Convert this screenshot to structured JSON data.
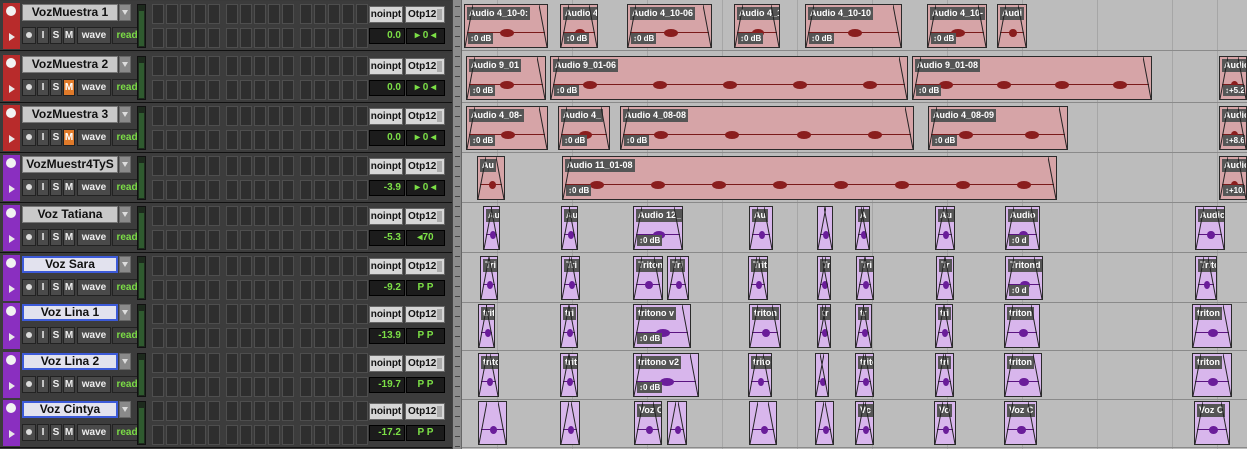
{
  "colors": {
    "audio_track_strip": "#b82b2b",
    "instrument_track_strip": "#8a2fc0",
    "audio_clip": "#d6a4a7",
    "instrument_clip": "#d8b6ec",
    "read_text": "#7bdc46",
    "mute_active": "#e07a2a"
  },
  "tracks": [
    {
      "name": "VozMuestra 1",
      "selected": false,
      "type": "audio",
      "input": "noinpt",
      "output": "Otp12",
      "volume": "0.0",
      "pan": "▸ 0 ◂",
      "mute_on": false,
      "rec": "●",
      "i": "I",
      "s": "S",
      "m": "M",
      "view": "wave",
      "automation": "read"
    },
    {
      "name": "VozMuestra 2",
      "selected": false,
      "type": "audio",
      "input": "noinpt",
      "output": "Otp12",
      "volume": "0.0",
      "pan": "▸ 0 ◂",
      "mute_on": true,
      "rec": "●",
      "i": "I",
      "s": "S",
      "m": "M",
      "view": "wave",
      "automation": "read"
    },
    {
      "name": "VozMuestra 3",
      "selected": false,
      "type": "audio",
      "input": "noinpt",
      "output": "Otp12",
      "volume": "0.0",
      "pan": "▸ 0 ◂",
      "mute_on": true,
      "rec": "●",
      "i": "I",
      "s": "S",
      "m": "M",
      "view": "wave",
      "automation": "read"
    },
    {
      "name": "VozMuestr4TyS",
      "selected": false,
      "type": "instrument",
      "input": "noinpt",
      "output": "Otp12",
      "volume": "-3.9",
      "pan": "▸ 0 ◂",
      "mute_on": false,
      "rec": "●",
      "i": "I",
      "s": "S",
      "m": "M",
      "view": "wave",
      "automation": "read"
    },
    {
      "name": "Voz Tatiana",
      "selected": false,
      "type": "instrument",
      "input": "noinpt",
      "output": "Otp12",
      "volume": "-5.3",
      "pan": "◂70",
      "mute_on": false,
      "rec": "●",
      "i": "I",
      "s": "S",
      "m": "M",
      "view": "wave",
      "automation": "read"
    },
    {
      "name": "Voz Sara",
      "selected": true,
      "type": "instrument",
      "input": "noinpt",
      "output": "Otp12",
      "volume": "-9.2",
      "pan": "P  P",
      "mute_on": false,
      "rec": "●",
      "i": "I",
      "s": "S",
      "m": "M",
      "view": "wave",
      "automation": "read"
    },
    {
      "name": "Voz Lina 1",
      "selected": true,
      "type": "instrument",
      "input": "noinpt",
      "output": "Otp12",
      "volume": "-13.9",
      "pan": "P  P",
      "mute_on": false,
      "rec": "●",
      "i": "I",
      "s": "S",
      "m": "M",
      "view": "wave",
      "automation": "read"
    },
    {
      "name": "Voz Lina 2",
      "selected": true,
      "type": "instrument",
      "input": "noinpt",
      "output": "Otp12",
      "volume": "-19.7",
      "pan": "P  P",
      "mute_on": false,
      "rec": "●",
      "i": "I",
      "s": "S",
      "m": "M",
      "view": "wave",
      "automation": "read"
    },
    {
      "name": "Voz Cintya",
      "selected": true,
      "type": "instrument",
      "input": "noinpt",
      "output": "Otp12",
      "volume": "-17.2",
      "pan": "P  P",
      "mute_on": false,
      "rec": "●",
      "i": "I",
      "s": "S",
      "m": "M",
      "view": "wave",
      "automation": "read"
    }
  ],
  "lanes": [
    {
      "color": "red",
      "clips": [
        {
          "label": "Audio 4_10-0:",
          "gain": "0 dB"
        },
        {
          "label": "Audio 4",
          "gain": "0 dB"
        },
        {
          "label": "Audio 4_10-06",
          "gain": "0 dB"
        },
        {
          "label": "Audio 4_1(",
          "gain": "0 dB"
        },
        {
          "label": "Audio 4_10-10",
          "gain": "0 dB"
        },
        {
          "label": "Audio 4_10-",
          "gain": "0 dB"
        },
        {
          "label": "Audi",
          "gain": ""
        }
      ]
    },
    {
      "color": "red",
      "clips": [
        {
          "label": "Audio 9_01",
          "gain": "0 dB"
        },
        {
          "label": "Audio 9_01-06",
          "gain": "0 dB"
        },
        {
          "label": "Audio 9_01-08",
          "gain": "0 dB"
        },
        {
          "label": "Audio !",
          "gain": "+5.2"
        }
      ]
    },
    {
      "color": "red",
      "clips": [
        {
          "label": "Audio 4_08-",
          "gain": "0 dB"
        },
        {
          "label": "Audio 4_",
          "gain": "0 dB"
        },
        {
          "label": "Audio 4_08-08",
          "gain": "0 dB"
        },
        {
          "label": "Audio 4_08-09",
          "gain": "0 dB"
        },
        {
          "label": "Audio ",
          "gain": "+8.6"
        }
      ]
    },
    {
      "color": "red",
      "clips": [
        {
          "label": "Au",
          "gain": ""
        },
        {
          "label": "Audio 11_01-08",
          "gain": "0 dB"
        },
        {
          "label": "Audio 1",
          "gain": "+10."
        }
      ]
    },
    {
      "color": "purple",
      "clips": [
        {
          "label": "Au",
          "gain": ""
        },
        {
          "label": "Au",
          "gain": ""
        },
        {
          "label": "Audio 12_",
          "gain": "0 dB"
        },
        {
          "label": "Au",
          "gain": ""
        },
        {
          "label": "",
          "gain": ""
        },
        {
          "label": "A",
          "gain": ""
        },
        {
          "label": "Au",
          "gain": ""
        },
        {
          "label": "Audio",
          "gain": "0 d"
        },
        {
          "label": "Audic",
          "gain": ""
        }
      ]
    },
    {
      "color": "purple",
      "clips": [
        {
          "label": "Tri",
          "gain": ""
        },
        {
          "label": "Tri",
          "gain": ""
        },
        {
          "label": "Triton",
          "gain": ""
        },
        {
          "label": "Tri",
          "gain": ""
        },
        {
          "label": "Trit",
          "gain": ""
        },
        {
          "label": "Tr",
          "gain": ""
        },
        {
          "label": "Tri",
          "gain": ""
        },
        {
          "label": "Tr",
          "gain": ""
        },
        {
          "label": "Tritond",
          "gain": "0 d"
        },
        {
          "label": "Trito",
          "gain": ""
        }
      ]
    },
    {
      "color": "purple",
      "clips": [
        {
          "label": "trit",
          "gain": ""
        },
        {
          "label": "tri",
          "gain": ""
        },
        {
          "label": "tritono v",
          "gain": "0 dB"
        },
        {
          "label": "triton",
          "gain": ""
        },
        {
          "label": "tr",
          "gain": ""
        },
        {
          "label": "tr",
          "gain": ""
        },
        {
          "label": "tri",
          "gain": ""
        },
        {
          "label": "triton",
          "gain": ""
        },
        {
          "label": "triton",
          "gain": ""
        }
      ]
    },
    {
      "color": "purple",
      "clips": [
        {
          "label": "trito",
          "gain": ""
        },
        {
          "label": "triti",
          "gain": ""
        },
        {
          "label": "tritono v2",
          "gain": "0 dB"
        },
        {
          "label": "trito",
          "gain": ""
        },
        {
          "label": "",
          "gain": ""
        },
        {
          "label": "tritc",
          "gain": ""
        },
        {
          "label": "tri",
          "gain": ""
        },
        {
          "label": "triton",
          "gain": ""
        },
        {
          "label": "triton",
          "gain": ""
        }
      ]
    },
    {
      "color": "purple",
      "clips": [
        {
          "label": "",
          "gain": ""
        },
        {
          "label": "",
          "gain": ""
        },
        {
          "label": "Voz C",
          "gain": ""
        },
        {
          "label": "",
          "gain": ""
        },
        {
          "label": "",
          "gain": ""
        },
        {
          "label": "",
          "gain": ""
        },
        {
          "label": "Vc",
          "gain": ""
        },
        {
          "label": "Vo",
          "gain": ""
        },
        {
          "label": "Voz C",
          "gain": ""
        },
        {
          "label": "Voz C",
          "gain": ""
        }
      ]
    }
  ]
}
